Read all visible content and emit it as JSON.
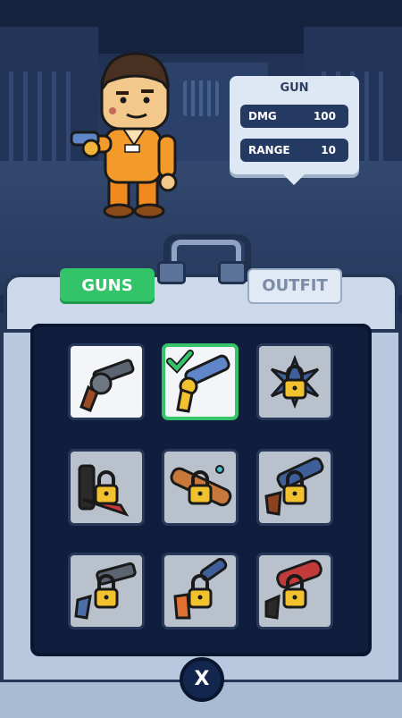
{
  "stats": {
    "title": "GUN",
    "rows": [
      {
        "label": "DMG",
        "value": "100"
      },
      {
        "label": "RANGE",
        "value": "10"
      }
    ]
  },
  "tabs": {
    "guns": "GUNS",
    "outfit": "OUTFIT",
    "active": "guns"
  },
  "weapons": [
    {
      "name": "revolver",
      "state": "unlocked"
    },
    {
      "name": "golden-pistol",
      "state": "selected"
    },
    {
      "name": "shuriken",
      "state": "locked"
    },
    {
      "name": "chainsaw",
      "state": "locked"
    },
    {
      "name": "bazooka",
      "state": "locked"
    },
    {
      "name": "blunderbuss",
      "state": "locked"
    },
    {
      "name": "heavy-revolver",
      "state": "locked"
    },
    {
      "name": "spiked-pistol",
      "state": "locked"
    },
    {
      "name": "flamethrower",
      "state": "locked"
    }
  ],
  "close_button": "X",
  "colors": {
    "accent_green": "#33c46a",
    "navy": "#253a63",
    "lock_gold": "#f2c12e"
  }
}
